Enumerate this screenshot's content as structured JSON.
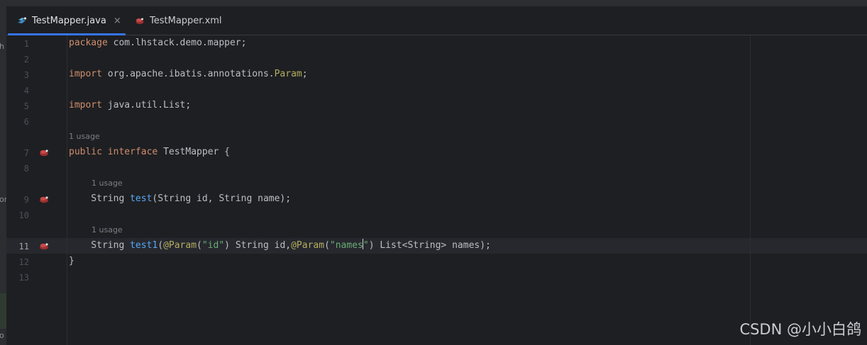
{
  "tabs": [
    {
      "label": "TestMapper.java",
      "active": true,
      "icon": "java-interface-icon"
    },
    {
      "label": "TestMapper.xml",
      "active": false,
      "icon": "mybatis-xml-icon"
    }
  ],
  "tab_close_glyph": "×",
  "side_fragments": [
    "h",
    "or",
    "o"
  ],
  "editor": {
    "line_numbers": [
      "1",
      "2",
      "3",
      "4",
      "5",
      "6",
      "7",
      "8",
      "9",
      "10",
      "11",
      "12",
      "13"
    ],
    "active_line": "11",
    "hints": {
      "usage_7": "1 usage",
      "usage_9": "1 usage",
      "usage_11": "1 usage"
    },
    "code": {
      "l1_kw": "package",
      "l1_rest": " com.lhstack.demo.mapper;",
      "l3_kw": "import",
      "l3_pkg": " org.apache.ibatis.annotations.",
      "l3_cls": "Param",
      "l3_semi": ";",
      "l5_kw": "import",
      "l5_rest": " java.util.List;",
      "l7_kw1": "public",
      "l7_sp": " ",
      "l7_kw2": "interface",
      "l7_rest": " TestMapper {",
      "l9_indent": "    String ",
      "l9_fn": "test",
      "l9_rest": "(String id, String name);",
      "l11_indent": "    String ",
      "l11_fn": "test1",
      "l11_p1": "(",
      "l11_ann1": "@Param",
      "l11_p2": "(",
      "l11_str1": "\"id\"",
      "l11_p3": ") String id,",
      "l11_ann2": "@Param",
      "l11_p4": "(",
      "l11_str2a": "\"names",
      "l11_str2b": "\"",
      "l11_p5": ") List<String> names);",
      "l12": "}"
    }
  },
  "watermark": "CSDN @小小白鸽",
  "colors": {
    "background": "#1e1f22",
    "keyword": "#cf8e6d",
    "annotation": "#b3ae60",
    "function": "#56a8f5",
    "string": "#6aab73",
    "tab_accent": "#3574f0"
  }
}
